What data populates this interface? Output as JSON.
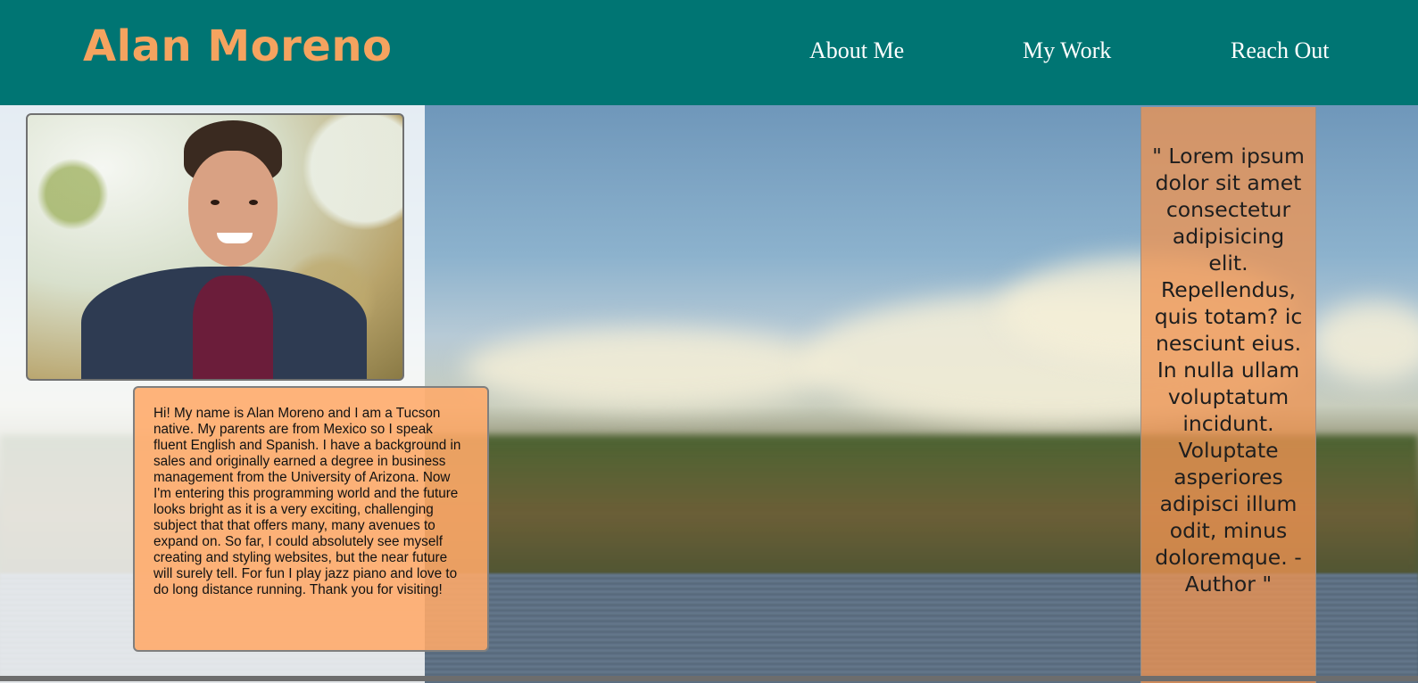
{
  "header": {
    "brand": "Alan Moreno",
    "nav": [
      "About Me",
      "My Work",
      "Reach Out"
    ]
  },
  "bio": {
    "text": "Hi! My name is Alan Moreno and I am a Tucson native. My parents are from Mexico so I speak fluent English and Spanish. I have a background in sales and originally earned a degree in business management from the University of Arizona. Now I'm entering this programming world and the future looks bright as it is a very exciting, challenging subject that that offers many, many avenues to expand on. So far, I could absolutely see myself creating and styling websites, but the near future will surely tell. For fun I play jazz piano and love to do long distance running. Thank you for visiting!"
  },
  "quote": {
    "text": "\" Lorem ipsum dolor sit amet consectetur adipisicing elit. Repellendus, quis totam? ic nesciunt eius. In nulla ullam voluptatum incidunt. Voluptate asperiores adipisci illum odit, minus doloremque. -Author \""
  },
  "colors": {
    "header_bg": "#007573",
    "brand": "#f5a35f",
    "nav_text": "#ffffff",
    "bio_bg": "#ffaa69",
    "quote_bg": "#ed9352"
  },
  "icons": {
    "portrait": "portrait-photo",
    "background": "lake-landscape-photo"
  }
}
